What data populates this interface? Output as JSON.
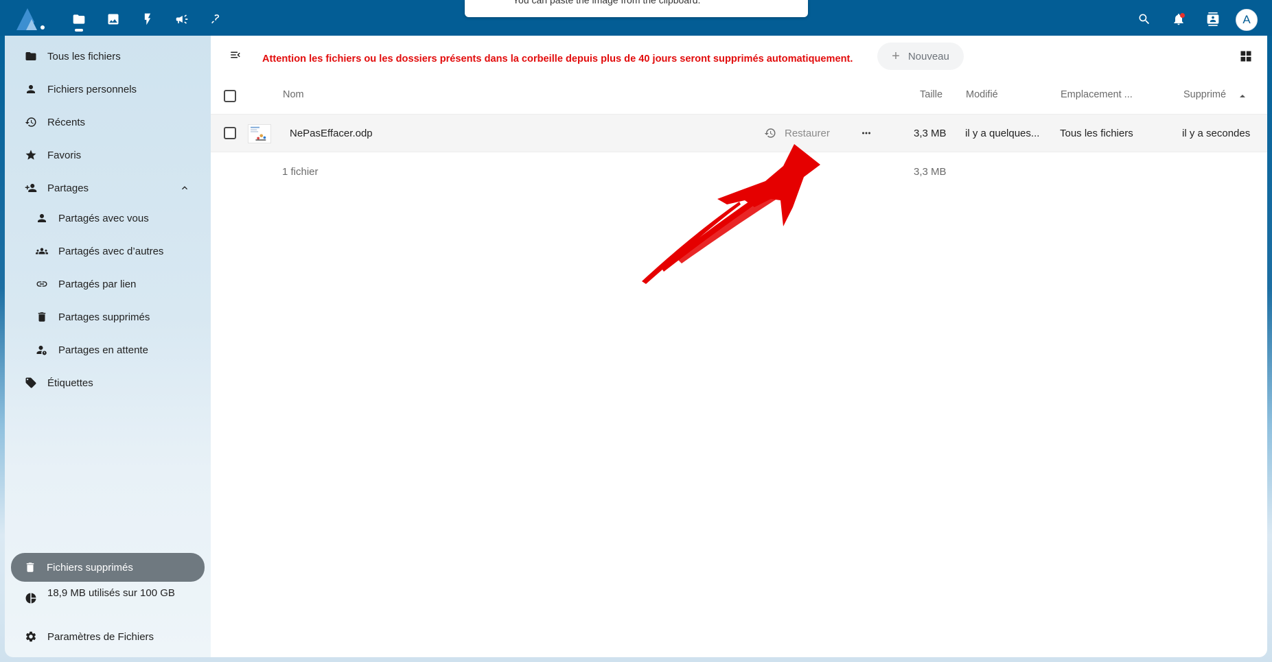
{
  "header": {
    "toast_text": "You can paste the image from the clipboard.",
    "avatar_letter": "A",
    "apps": [
      "files-icon",
      "photos-icon",
      "activity-icon",
      "announcements-icon",
      "flow-icon"
    ]
  },
  "sidebar": {
    "items": [
      {
        "label": "Tous les fichiers",
        "icon": "folder-icon"
      },
      {
        "label": "Fichiers personnels",
        "icon": "user-icon"
      },
      {
        "label": "Récents",
        "icon": "history-icon"
      },
      {
        "label": "Favoris",
        "icon": "star-icon"
      },
      {
        "label": "Partages",
        "icon": "share-user-icon"
      },
      {
        "label": "Partagés avec vous",
        "icon": "user-icon"
      },
      {
        "label": "Partagés avec d’autres",
        "icon": "group-icon"
      },
      {
        "label": "Partagés par lien",
        "icon": "link-icon"
      },
      {
        "label": "Partages supprimés",
        "icon": "trash-icon"
      },
      {
        "label": "Partages en attente",
        "icon": "user-clock-icon"
      },
      {
        "label": "Étiquettes",
        "icon": "tags-icon"
      }
    ],
    "deleted_files": "Fichiers supprimés",
    "quota": "18,9 MB utilisés sur 100 GB",
    "settings": "Paramètres de Fichiers"
  },
  "main": {
    "warning": "Attention les fichiers ou les dossiers présents dans la corbeille depuis plus de 40 jours seront supprimés automatiquement.",
    "new_button": "Nouveau",
    "columns": {
      "name": "Nom",
      "size": "Taille",
      "modified": "Modifié",
      "location": "Emplacement ...",
      "deleted": "Supprimé"
    },
    "file": {
      "name": "NePasEffacer.odp",
      "restore_label": "Restaurer",
      "size": "3,3 MB",
      "modified": "il y a quelques...",
      "location": "Tous les fichiers",
      "deleted": "il y a secondes"
    },
    "summary": {
      "count": "1 fichier",
      "size": "3,3 MB"
    },
    "annotation_color": "#e50000"
  }
}
